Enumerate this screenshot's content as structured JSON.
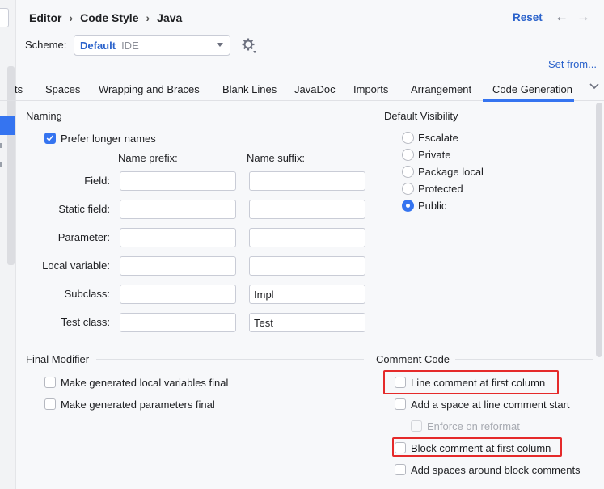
{
  "header": {
    "breadcrumbs": [
      "Editor",
      "Code Style",
      "Java"
    ],
    "reset_label": "Reset",
    "back_icon": "arrow-left-icon",
    "forward_icon": "arrow-right-icon"
  },
  "scheme": {
    "label": "Scheme:",
    "name": "Default",
    "kind": "IDE",
    "set_from_label": "Set from..."
  },
  "tabs": {
    "items": [
      "ts",
      "Spaces",
      "Wrapping and Braces",
      "Blank Lines",
      "JavaDoc",
      "Imports",
      "Arrangement",
      "Code Generation"
    ],
    "selected": "Code Generation"
  },
  "naming": {
    "title": "Naming",
    "prefer_longer": {
      "label": "Prefer longer names",
      "checked": true
    },
    "prefix_header": "Name prefix:",
    "suffix_header": "Name suffix:",
    "rows": [
      {
        "label": "Field:",
        "prefix": "",
        "suffix": ""
      },
      {
        "label": "Static field:",
        "prefix": "",
        "suffix": ""
      },
      {
        "label": "Parameter:",
        "prefix": "",
        "suffix": ""
      },
      {
        "label": "Local variable:",
        "prefix": "",
        "suffix": ""
      },
      {
        "label": "Subclass:",
        "prefix": "",
        "suffix": "Impl"
      },
      {
        "label": "Test class:",
        "prefix": "",
        "suffix": "Test"
      }
    ]
  },
  "visibility": {
    "title": "Default Visibility",
    "options": [
      {
        "label": "Escalate",
        "checked": false
      },
      {
        "label": "Private",
        "checked": false
      },
      {
        "label": "Package local",
        "checked": false
      },
      {
        "label": "Protected",
        "checked": false
      },
      {
        "label": "Public",
        "checked": true
      }
    ]
  },
  "final_modifier": {
    "title": "Final Modifier",
    "options": [
      {
        "label": "Make generated local variables final",
        "checked": false
      },
      {
        "label": "Make generated parameters final",
        "checked": false
      }
    ]
  },
  "comment_code": {
    "title": "Comment Code",
    "options": [
      {
        "label": "Line comment at first column",
        "checked": false,
        "enabled": true,
        "highlighted": true
      },
      {
        "label": "Add a space at line comment start",
        "checked": false,
        "enabled": true,
        "highlighted": false
      },
      {
        "label": "Enforce on reformat",
        "checked": false,
        "enabled": false,
        "highlighted": false
      },
      {
        "label": "Block comment at first column",
        "checked": false,
        "enabled": true,
        "highlighted": true
      },
      {
        "label": "Add spaces around block comments",
        "checked": false,
        "enabled": true,
        "highlighted": false
      }
    ]
  },
  "colors": {
    "accent": "#3574f0",
    "link": "#2a62cb",
    "highlight_box": "#e52a2a"
  }
}
